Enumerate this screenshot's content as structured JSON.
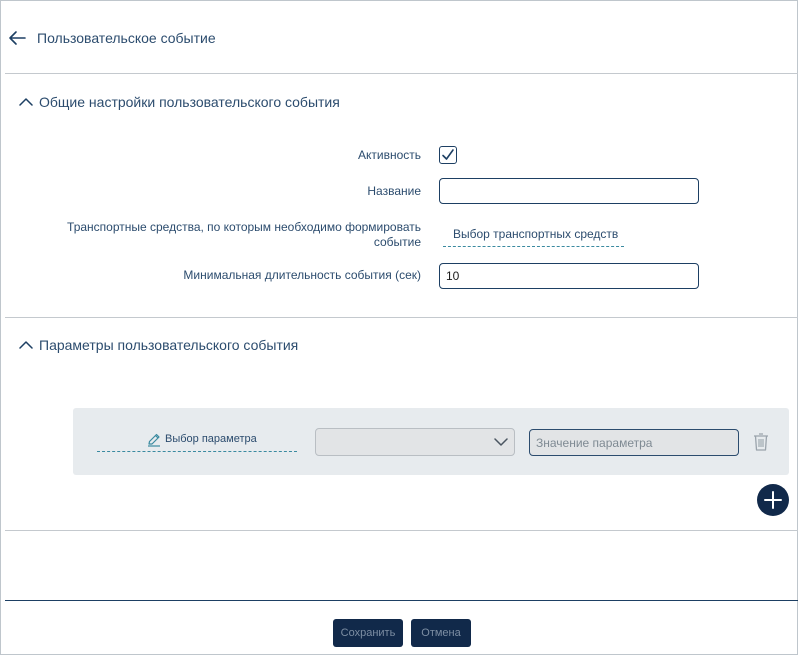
{
  "header": {
    "title": "Пользовательское событие"
  },
  "general_section": {
    "title": "Общие настройки пользовательского события",
    "fields": {
      "activity_label": "Активность",
      "activity_checked": true,
      "name_label": "Название",
      "name_value": "",
      "vehicles_label": "Транспортные средства, по которым необходимо формировать событие",
      "vehicles_link": "Выбор транспортных средств",
      "min_duration_label": "Минимальная длительность события (сек)",
      "min_duration_value": "10"
    }
  },
  "params_section": {
    "title": "Параметры пользовательского события",
    "row": {
      "param_link": "Выбор параметра",
      "select_value": "",
      "value_placeholder": "Значение параметра"
    }
  },
  "footer": {
    "save_label": "Сохранить",
    "cancel_label": "Отмена"
  },
  "colors": {
    "text": "#2c4c6e",
    "dark_navy": "#11294a",
    "panel_bg": "#e7ebee",
    "dashed_underline": "#3a8aa0"
  }
}
